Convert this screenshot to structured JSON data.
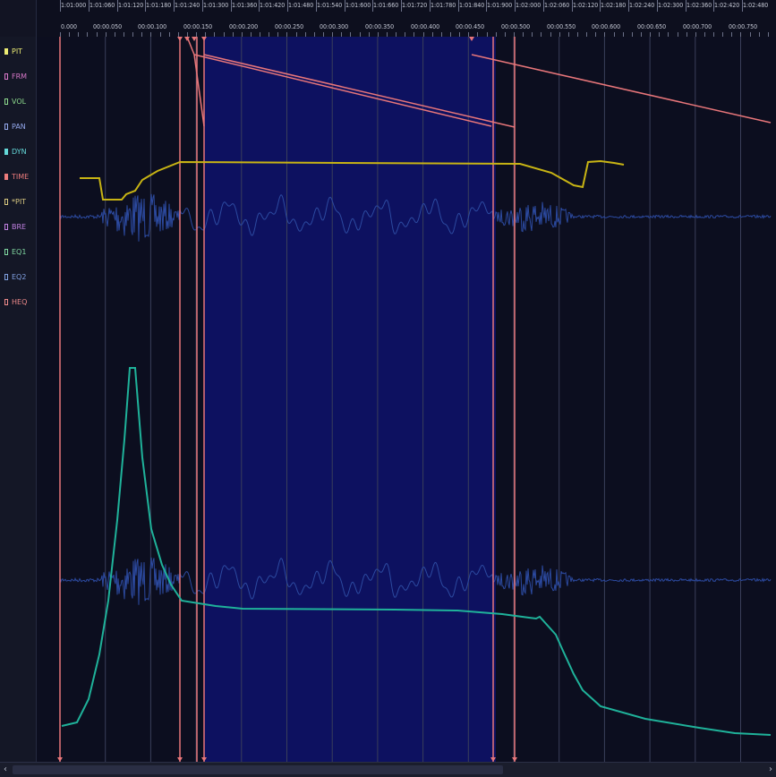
{
  "params": [
    {
      "label": "PIT",
      "color": "#ecec74",
      "filled": true
    },
    {
      "label": "FRM",
      "color": "#d878c8",
      "filled": false
    },
    {
      "label": "VOL",
      "color": "#8cd88c",
      "filled": false
    },
    {
      "label": "PAN",
      "color": "#94a8ec",
      "filled": false
    },
    {
      "label": "DYN",
      "color": "#64d8d8",
      "filled": true
    },
    {
      "label": "TIME",
      "color": "#ec7c7c",
      "filled": true
    },
    {
      "label": "*PIT",
      "color": "#d8c880",
      "filled": false
    },
    {
      "label": "BRE",
      "color": "#c080e0",
      "filled": false
    },
    {
      "label": "EQ1",
      "color": "#80d8a0",
      "filled": false
    },
    {
      "label": "EQ2",
      "color": "#80a0e0",
      "filled": false
    },
    {
      "label": "HEQ",
      "color": "#ec8a8a",
      "filled": false
    }
  ],
  "ruler": {
    "top_ticks": [
      "1:01:000",
      "1:01:060",
      "1:01:120",
      "1:01:180",
      "1:01:240",
      "1:01:300",
      "1:01:360",
      "1:01:420",
      "1:01:480",
      "1:01:540",
      "1:01:600",
      "1:01:660",
      "1:01:720",
      "1:01:780",
      "1:01:840",
      "1:01:900",
      "1:02:000",
      "1:02:060",
      "1:02:120",
      "1:02:180",
      "1:02:240",
      "1:02:300",
      "1:02:360",
      "1:02:420",
      "1:02:480"
    ],
    "bottom_ticks": [
      "0.000",
      "00:00.050",
      "00:00.100",
      "00:00.150",
      "00:00.200",
      "00:00.250",
      "00:00.300",
      "00:00.350",
      "00:00.400",
      "00:00.450",
      "00:00.500",
      "00:00.550",
      "00:00.600",
      "00:00.650",
      "00:00.700",
      "00:00.750"
    ]
  },
  "colors": {
    "background": "#0c0e1f",
    "selection": "#0d1160",
    "pitch_curve": "#c8b414",
    "dynamics_curve": "#1fb29a",
    "waveform": "#2c4aa0",
    "time_markers": "#e8767a"
  },
  "scroll": {
    "left_icon": "‹",
    "right_icon": "›"
  }
}
